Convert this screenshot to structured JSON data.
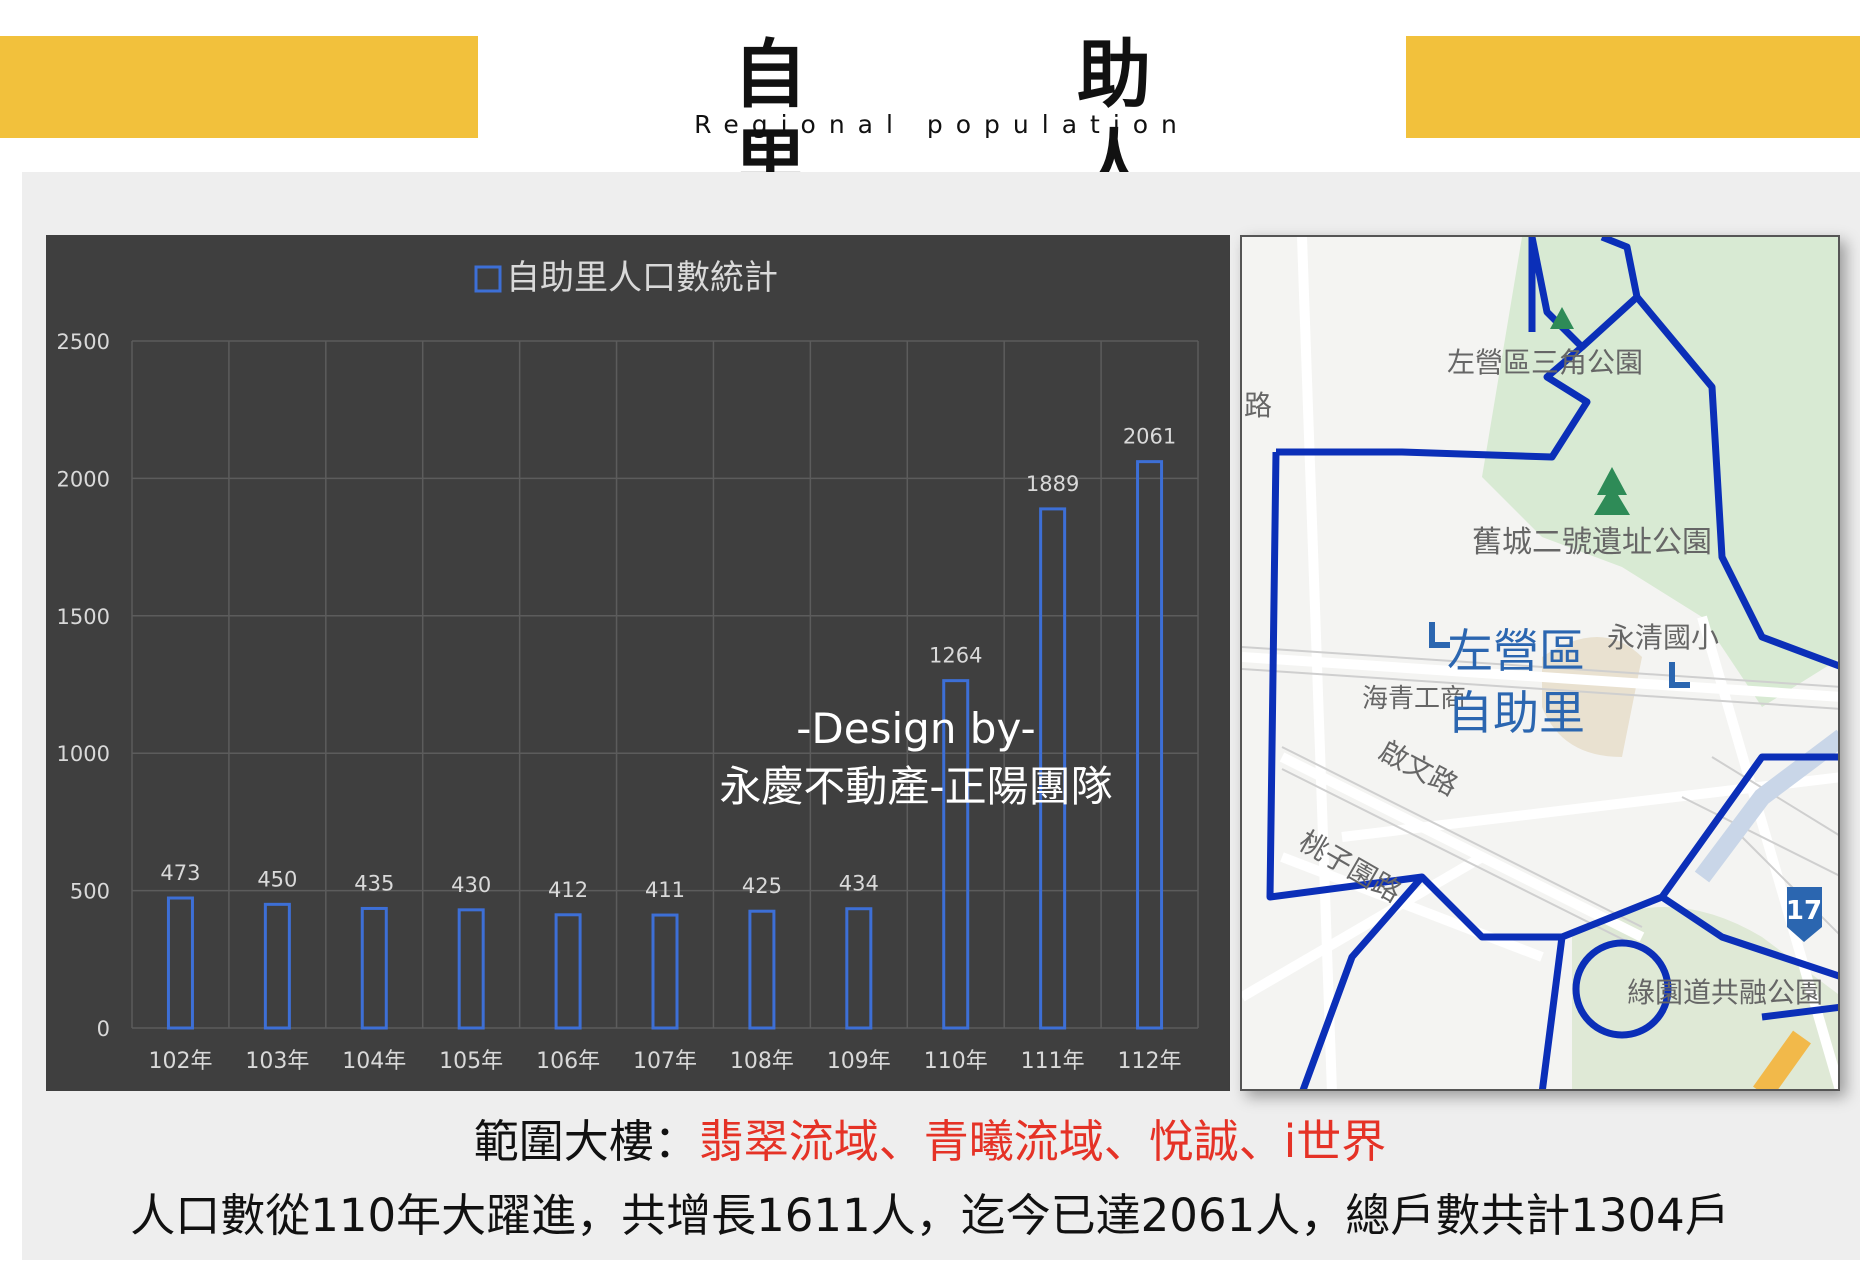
{
  "header": {
    "title": "自　助　里　人　口",
    "subtitle": "Regional population"
  },
  "chart_data": {
    "type": "bar",
    "title": "自助里人口數統計",
    "categories": [
      "102年",
      "103年",
      "104年",
      "105年",
      "106年",
      "107年",
      "108年",
      "109年",
      "110年",
      "111年",
      "112年"
    ],
    "values": [
      473,
      450,
      435,
      430,
      412,
      411,
      425,
      434,
      1264,
      1889,
      2061
    ],
    "y_ticks": [
      0,
      500,
      1000,
      1500,
      2000,
      2500
    ],
    "ylim": [
      0,
      2500
    ],
    "grid": true,
    "legend": "top-center",
    "colors": {
      "bar_stroke": "#3d6fd6",
      "background": "#3f3f3f",
      "grid": "#5c5c5c",
      "text": "#d9d9d9"
    }
  },
  "watermark": {
    "line1": "-Design by-",
    "line2": "永慶不動產-正陽團隊"
  },
  "map": {
    "labels": {
      "park1": "左營區三角公園",
      "park2": "舊城二號遺址公園",
      "school": "永清國小",
      "district": "左營區",
      "village": "自助里",
      "road_haiqing": "海青工商",
      "road_qiwen": "啟文路",
      "road_taozi": "桃子園路",
      "park3": "綠園道共融公園",
      "road_side": "路",
      "route_badge": "17"
    }
  },
  "captions": {
    "line1_prefix": "範圍大樓：",
    "line1_highlight": "翡翠流域、青曦流域、悅誠、i世界",
    "line2": "人口數從110年大躍進，共增長1611人，迄今已達2061人，總戶數共計1304戶"
  }
}
